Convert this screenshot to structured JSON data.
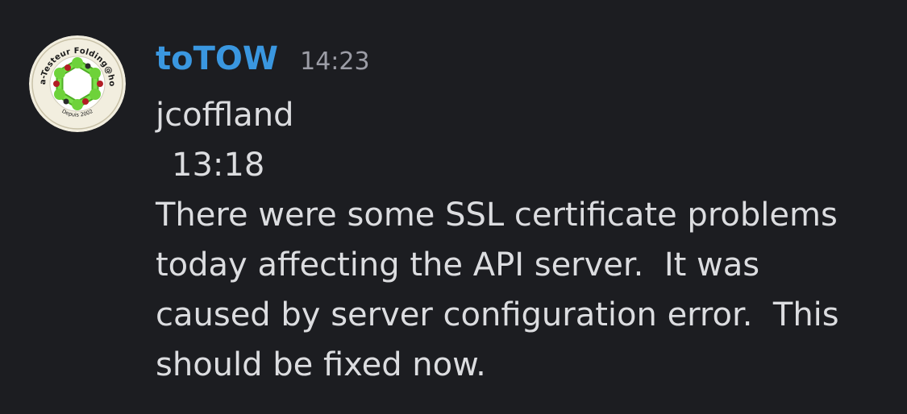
{
  "message": {
    "author": "toTOW",
    "time": "14:23",
    "avatar": {
      "icon": "folding-at-home-beta-tester-badge",
      "text_top": "Béta-Testeur Folding@home",
      "text_bottom": "Depuis 2002",
      "colors": {
        "ring": "#f2eedf",
        "inner": "#ffffff",
        "molecule": "#6ed23a",
        "atoms": "#b21d24",
        "text": "#1a1a1a"
      }
    },
    "lines": [
      "jcoffland",
      "13:18",
      "There were some SSL certificate problems",
      "today affecting the API server.  It was",
      "caused by server configuration error.  This",
      "should be fixed now."
    ]
  },
  "colors": {
    "background": "#1c1d21",
    "username": "#3a97e0",
    "timestamp": "#9c9da6",
    "text": "#dcdde0"
  }
}
